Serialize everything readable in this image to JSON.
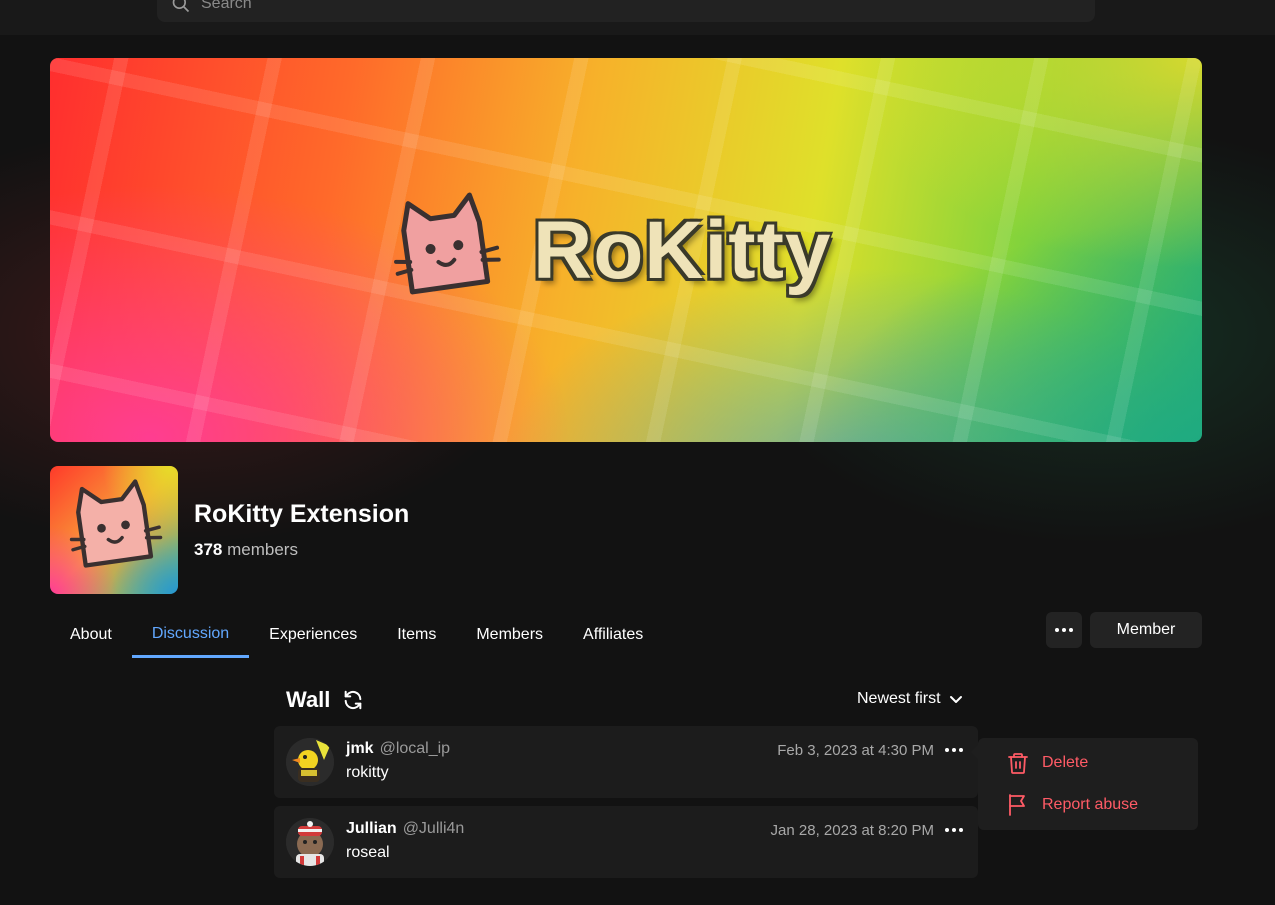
{
  "search": {
    "placeholder": "Search",
    "icon": "search-icon"
  },
  "banner": {
    "wordmark": "RoKitty",
    "colors": [
      "#ff2e2e",
      "#f7b12a",
      "#dfe02a",
      "#2bb06e",
      "#ff3c96"
    ]
  },
  "group": {
    "name": "RoKitty Extension",
    "member_count": "378",
    "members_suffix": "members"
  },
  "tabs": [
    {
      "label": "About",
      "active": false
    },
    {
      "label": "Discussion",
      "active": true
    },
    {
      "label": "Experiences",
      "active": false
    },
    {
      "label": "Items",
      "active": false
    },
    {
      "label": "Members",
      "active": false
    },
    {
      "label": "Affiliates",
      "active": false
    }
  ],
  "actions": {
    "more_icon": "ellipsis-icon",
    "member_label": "Member"
  },
  "wall": {
    "title": "Wall",
    "refresh_icon": "refresh-icon",
    "sort_label": "Newest first",
    "sort_icon": "chevron-down-icon"
  },
  "posts": [
    {
      "name": "jmk",
      "handle": "@local_ip",
      "body": "rokitty",
      "date": "Feb 3, 2023 at 4:30 PM"
    },
    {
      "name": "Jullian",
      "handle": "@Julli4n",
      "body": "roseal",
      "date": "Jan 28, 2023 at 8:20 PM"
    }
  ],
  "context_menu": {
    "delete_label": "Delete",
    "report_label": "Report abuse",
    "accent": "#ff5b66"
  },
  "accent_color": "#62a8ff"
}
